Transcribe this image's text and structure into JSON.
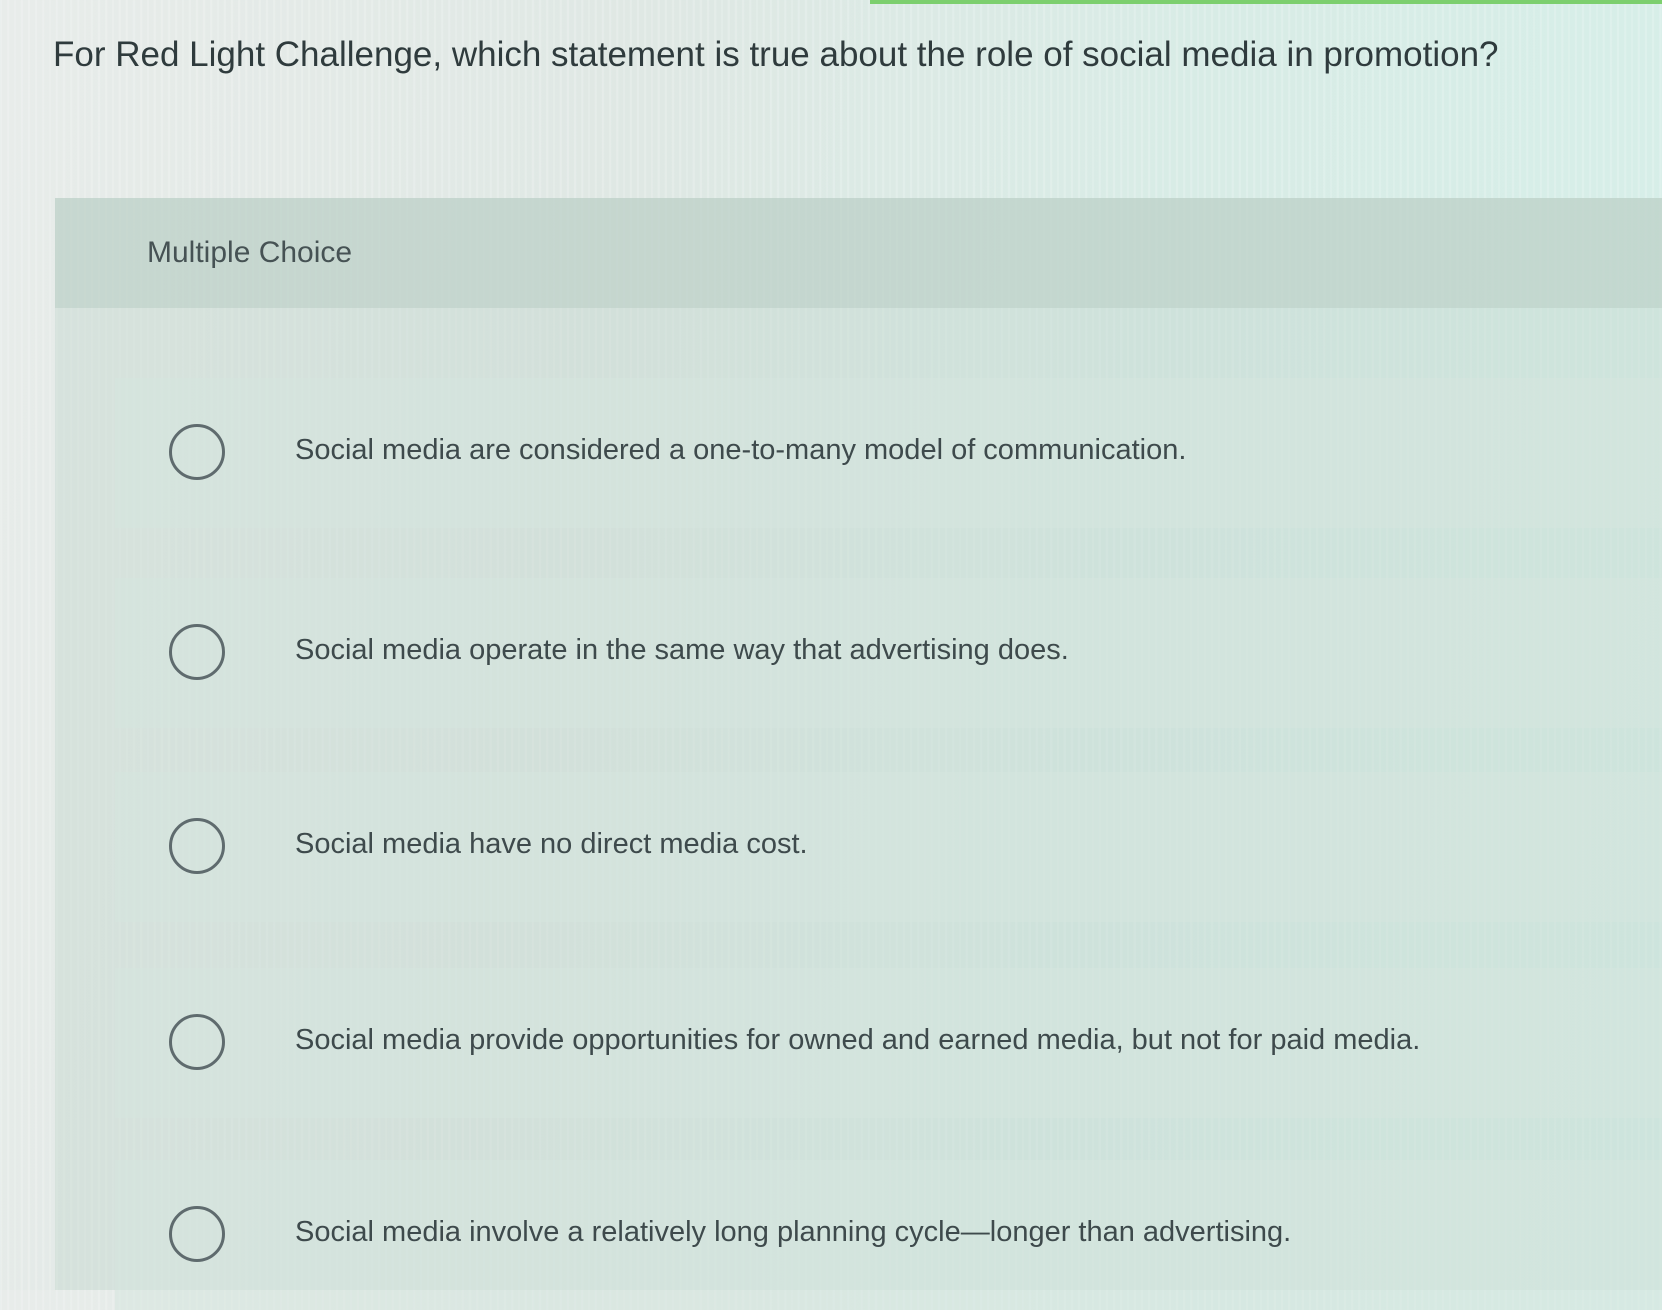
{
  "question": {
    "text": "For Red Light Challenge, which statement is true about the role of social media in promotion?"
  },
  "panel": {
    "title": "Multiple Choice"
  },
  "options": [
    {
      "label": "Social media are considered a one-to-many model of communication."
    },
    {
      "label": "Social media operate in the same way that advertising does."
    },
    {
      "label": "Social media have no direct media cost."
    },
    {
      "label": "Social media provide opportunities for owned and earned media, but not for paid media."
    },
    {
      "label": "Social media involve a relatively long planning cycle—longer than advertising."
    }
  ],
  "colors": {
    "accent": "#7ccf6e",
    "text": "#2f3b3d",
    "radio_border": "#5f6b6e"
  }
}
